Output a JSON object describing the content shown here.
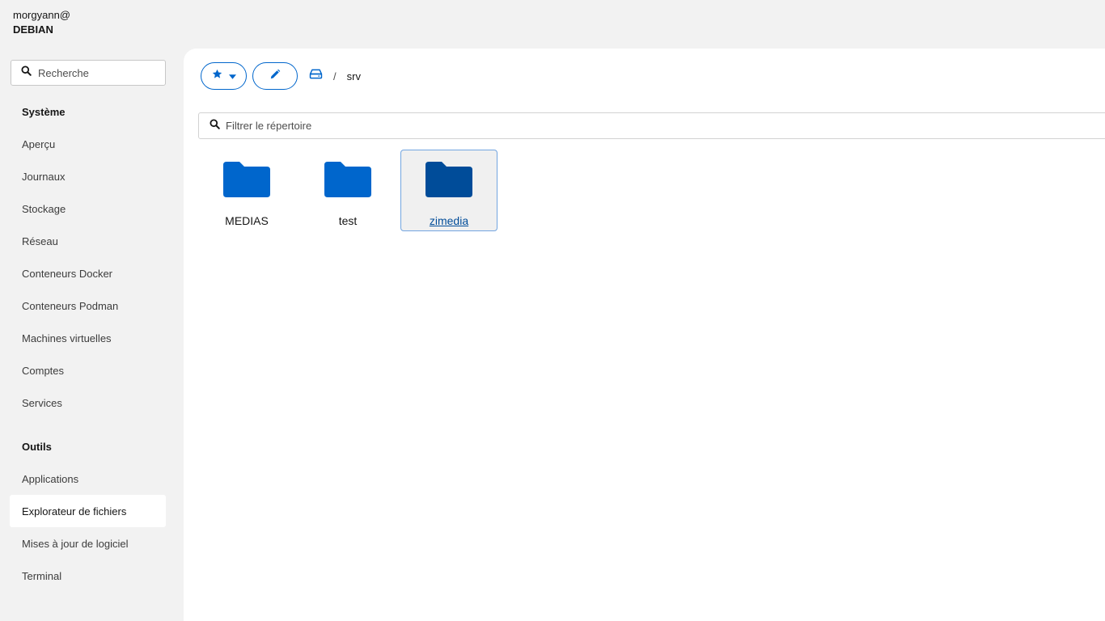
{
  "host": {
    "user": "morgyann@",
    "name": "DEBIAN"
  },
  "sidebar": {
    "search_placeholder": "Recherche",
    "sections": [
      {
        "title": "Système",
        "items": [
          "Aperçu",
          "Journaux",
          "Stockage",
          "Réseau",
          "Conteneurs Docker",
          "Conteneurs Podman",
          "Machines virtuelles",
          "Comptes",
          "Services"
        ]
      },
      {
        "title": "Outils",
        "items": [
          "Applications",
          "Explorateur de fichiers",
          "Mises à jour de logiciel",
          "Terminal"
        ]
      }
    ],
    "active_item": "Explorateur de fichiers"
  },
  "breadcrumb": {
    "separator": "/",
    "path": "srv"
  },
  "filter": {
    "placeholder": "Filtrer le répertoire"
  },
  "folders": [
    {
      "name": "MEDIAS",
      "selected": false
    },
    {
      "name": "test",
      "selected": false
    },
    {
      "name": "zimedia",
      "selected": true
    }
  ],
  "colors": {
    "accent": "#0066cc",
    "folder": "#0066cc",
    "folder_selected": "#004c99"
  },
  "icons": [
    "search-icon",
    "star-icon",
    "caret-down-icon",
    "pencil-icon",
    "drive-icon",
    "folder-icon"
  ]
}
